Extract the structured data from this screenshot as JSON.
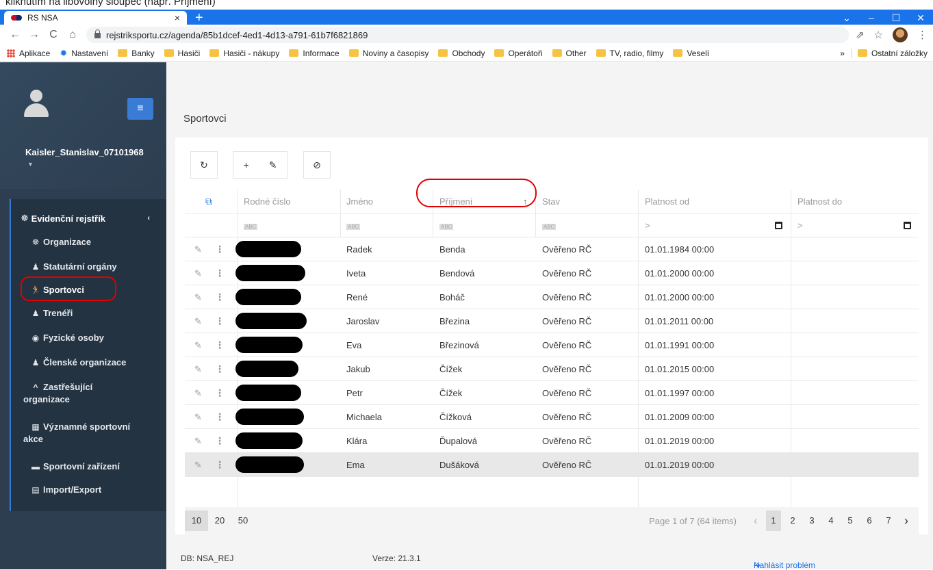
{
  "caption": "kliknutím na libovolný sloupec (např. Příjmení)",
  "browser": {
    "tab_title": "RS NSA",
    "tab_close": "×",
    "new_tab": "+",
    "url": "rejstriksportu.cz/agenda/85b1dcef-4ed1-4d13-a791-61b7f6821869",
    "bookmarks": [
      "Aplikace",
      "Nastavení",
      "Banky",
      "Hasiči",
      "Hasiči - nákupy",
      "Informace",
      "Noviny a časopisy",
      "Obchody",
      "Operátoři",
      "Other",
      "TV, radio, filmy",
      "Veselí"
    ],
    "bookmarks_more": "»",
    "other_bookmarks": "Ostatní záložky"
  },
  "sidebar": {
    "user_name": "Kaisler_Stanislav_07101968",
    "root_label": "Evidenční rejstřík",
    "items": [
      {
        "label": "Organizace",
        "icon": "☸"
      },
      {
        "label": "Statutární orgány",
        "icon": "♟"
      },
      {
        "label": "Sportovci",
        "icon": "🏃"
      },
      {
        "label": "Trenéři",
        "icon": "♟"
      },
      {
        "label": "Fyzické osoby",
        "icon": "◉"
      },
      {
        "label": "Členské organizace",
        "icon": "♟"
      },
      {
        "label": "Zastřešující",
        "label2": "organizace",
        "icon": "^"
      },
      {
        "label": "Významné sportovní",
        "label2": "akce",
        "icon": "▦"
      },
      {
        "label": "Sportovní zařízení",
        "icon": "▬"
      },
      {
        "label": "Import/Export",
        "icon": "▤"
      }
    ]
  },
  "main": {
    "title": "Sportovci",
    "columns": {
      "rc": "Rodné číslo",
      "jmeno": "Jméno",
      "prijmeni": "Příjmení",
      "stav": "Stav",
      "od": "Platnost od",
      "do": "Platnost do"
    },
    "sort_indicator": "↑",
    "filter_abc": "ABC",
    "filter_gt": ">",
    "rows": [
      {
        "jmeno": "Radek",
        "prijmeni": "Benda",
        "stav": "Ověřeno RČ",
        "od": "01.01.1984 00:00"
      },
      {
        "jmeno": "Iveta",
        "prijmeni": "Bendová",
        "stav": "Ověřeno RČ",
        "od": "01.01.2000 00:00"
      },
      {
        "jmeno": "René",
        "prijmeni": "Boháč",
        "stav": "Ověřeno RČ",
        "od": "01.01.2000 00:00"
      },
      {
        "jmeno": "Jaroslav",
        "prijmeni": "Březina",
        "stav": "Ověřeno RČ",
        "od": "01.01.2011 00:00"
      },
      {
        "jmeno": "Eva",
        "prijmeni": "Březinová",
        "stav": "Ověřeno RČ",
        "od": "01.01.1991 00:00"
      },
      {
        "jmeno": "Jakub",
        "prijmeni": "Čížek",
        "stav": "Ověřeno RČ",
        "od": "01.01.2015 00:00"
      },
      {
        "jmeno": "Petr",
        "prijmeni": "Čížek",
        "stav": "Ověřeno RČ",
        "od": "01.01.1997 00:00"
      },
      {
        "jmeno": "Michaela",
        "prijmeni": "Čížková",
        "stav": "Ověřeno RČ",
        "od": "01.01.2009 00:00"
      },
      {
        "jmeno": "Klára",
        "prijmeni": "Ďupalová",
        "stav": "Ověřeno RČ",
        "od": "01.01.2019 00:00"
      },
      {
        "jmeno": "Ema",
        "prijmeni": "Dušáková",
        "stav": "Ověřeno RČ",
        "od": "01.01.2019 00:00"
      }
    ],
    "page_sizes": [
      "10",
      "20",
      "50"
    ],
    "page_info": "Page 1 of 7 (64 items)",
    "pages": [
      "1",
      "2",
      "3",
      "4",
      "5",
      "6",
      "7"
    ]
  },
  "footer": {
    "db": "DB: NSA_REJ",
    "version": "Verze: 21.3.1",
    "report": "Nahlásit problém"
  },
  "colors": {
    "sidebar": "#2c3e50",
    "accent": "#1a73e8",
    "annotation": "#e00000"
  }
}
